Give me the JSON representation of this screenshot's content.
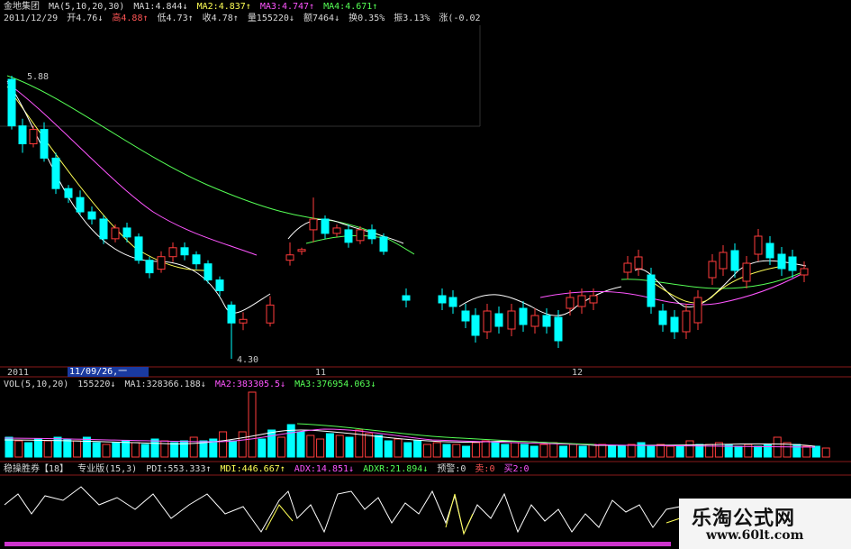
{
  "header": {
    "line1": {
      "stock_name": "金地集团",
      "ma_params": "MA(5,10,20,30)",
      "ma1": "MA1:4.844↓",
      "ma2": "MA2:4.837↑",
      "ma3": "MA3:4.747↑",
      "ma4": "MA4:4.671↑"
    },
    "line2": {
      "date": "2011/12/29",
      "open": "开4.76↓",
      "high": "高4.88↑",
      "low": "低4.73↑",
      "close": "收4.78↑",
      "volume": "量155220↓",
      "amount": "额7464↓",
      "turnover": "换0.35%",
      "amplitude": "振3.13%",
      "change": "涨(-0.02"
    }
  },
  "price_chart": {
    "high_label": "5.88",
    "low_label": "4.30"
  },
  "time_axis": {
    "year_label": "2011",
    "cursor_date": "11/09/26,一",
    "month_11": "11",
    "month_12": "12"
  },
  "vol_header": {
    "params": "VOL(5,10,20)",
    "vol": "155220↓",
    "ma1": "MA1:328366.188↓",
    "ma2": "MA2:383305.5↓",
    "ma3": "MA3:376954.063↓"
  },
  "ind_header": {
    "name": "稳操胜券【18】",
    "ver": "专业版(15,3)",
    "pdi": "PDI:553.333↑",
    "mdi": "MDI:446.667↑",
    "adx": "ADX:14.851↓",
    "adxr": "ADXR:21.894↓",
    "warn": "预警:0",
    "sell": "卖:0",
    "buy": "买2:0"
  },
  "watermark": {
    "title": "乐淘公式网",
    "url": "www.60lt.com"
  },
  "colors": {
    "up": "#ff3b3b",
    "down": "#00ffff",
    "ma5": "#ffffff",
    "ma10": "#ffff00",
    "ma20": "#ff55ff",
    "ma30": "#55ff55"
  },
  "chart_data": {
    "type": "candlestick",
    "price_scale": [
      4.3,
      5.88
    ],
    "candles": [
      [
        5.86,
        5.6,
        5.88,
        5.58
      ],
      [
        5.6,
        5.5,
        5.64,
        5.45
      ],
      [
        5.5,
        5.58,
        5.6,
        5.48
      ],
      [
        5.58,
        5.42,
        5.62,
        5.4
      ],
      [
        5.42,
        5.25,
        5.45,
        5.22
      ],
      [
        5.25,
        5.2,
        5.27,
        5.17
      ],
      [
        5.2,
        5.12,
        5.24,
        5.1
      ],
      [
        5.12,
        5.08,
        5.15,
        5.05
      ],
      [
        5.08,
        4.97,
        5.1,
        4.94
      ],
      [
        4.97,
        5.03,
        5.05,
        4.95
      ],
      [
        5.03,
        4.98,
        5.06,
        4.95
      ],
      [
        4.98,
        4.85,
        5.0,
        4.83
      ],
      [
        4.85,
        4.78,
        4.87,
        4.75
      ],
      [
        4.8,
        4.87,
        4.9,
        4.78
      ],
      [
        4.87,
        4.92,
        4.95,
        4.84
      ],
      [
        4.92,
        4.88,
        4.95,
        4.85
      ],
      [
        4.88,
        4.83,
        4.9,
        4.8
      ],
      [
        4.83,
        4.74,
        4.85,
        4.72
      ],
      [
        4.74,
        4.68,
        4.76,
        4.65
      ],
      [
        4.6,
        4.5,
        4.62,
        4.3
      ],
      [
        4.5,
        4.52,
        4.56,
        4.46
      ],
      [
        4.5,
        4.6,
        4.65,
        4.48
      ],
      [
        4.85,
        4.88,
        4.95,
        4.82
      ],
      [
        4.9,
        4.91,
        4.92,
        4.88
      ],
      [
        5.02,
        5.08,
        5.2,
        4.95
      ],
      [
        5.08,
        5.0,
        5.1,
        4.97
      ],
      [
        5.0,
        5.03,
        5.05,
        4.98
      ],
      [
        5.02,
        4.95,
        5.05,
        4.92
      ],
      [
        4.96,
        5.02,
        5.04,
        4.94
      ],
      [
        5.02,
        4.97,
        5.05,
        4.94
      ],
      [
        4.98,
        4.9,
        5.0,
        4.88
      ]
    ]
  }
}
